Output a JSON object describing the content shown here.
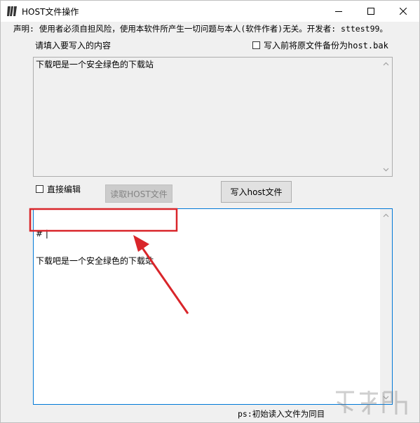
{
  "window": {
    "title": "HOST文件操作",
    "icon": "host-app-icon"
  },
  "declaration": "声明: 使用者必须自担风险，使用本软件所产生一切问题与本人(软件作者)无关。开发者: sttest99。",
  "input_section": {
    "label": "请填入要写入的内容",
    "backup_checkbox_label": "写入前将原文件备份为host.bak",
    "backup_checked": false,
    "content": "下载吧是一个安全绿色的下载站"
  },
  "controls": {
    "direct_edit_label": "直接编辑",
    "direct_edit_checked": false,
    "read_button": "读取HOST文件",
    "write_button": "写入host文件"
  },
  "output_section": {
    "lines": [
      "# |",
      "下载吧是一个安全绿色的下载站"
    ]
  },
  "status_text": "ps:初始读入文件为同目",
  "colors": {
    "annotation_red": "#d9252a",
    "focus_border": "#0078d7"
  }
}
